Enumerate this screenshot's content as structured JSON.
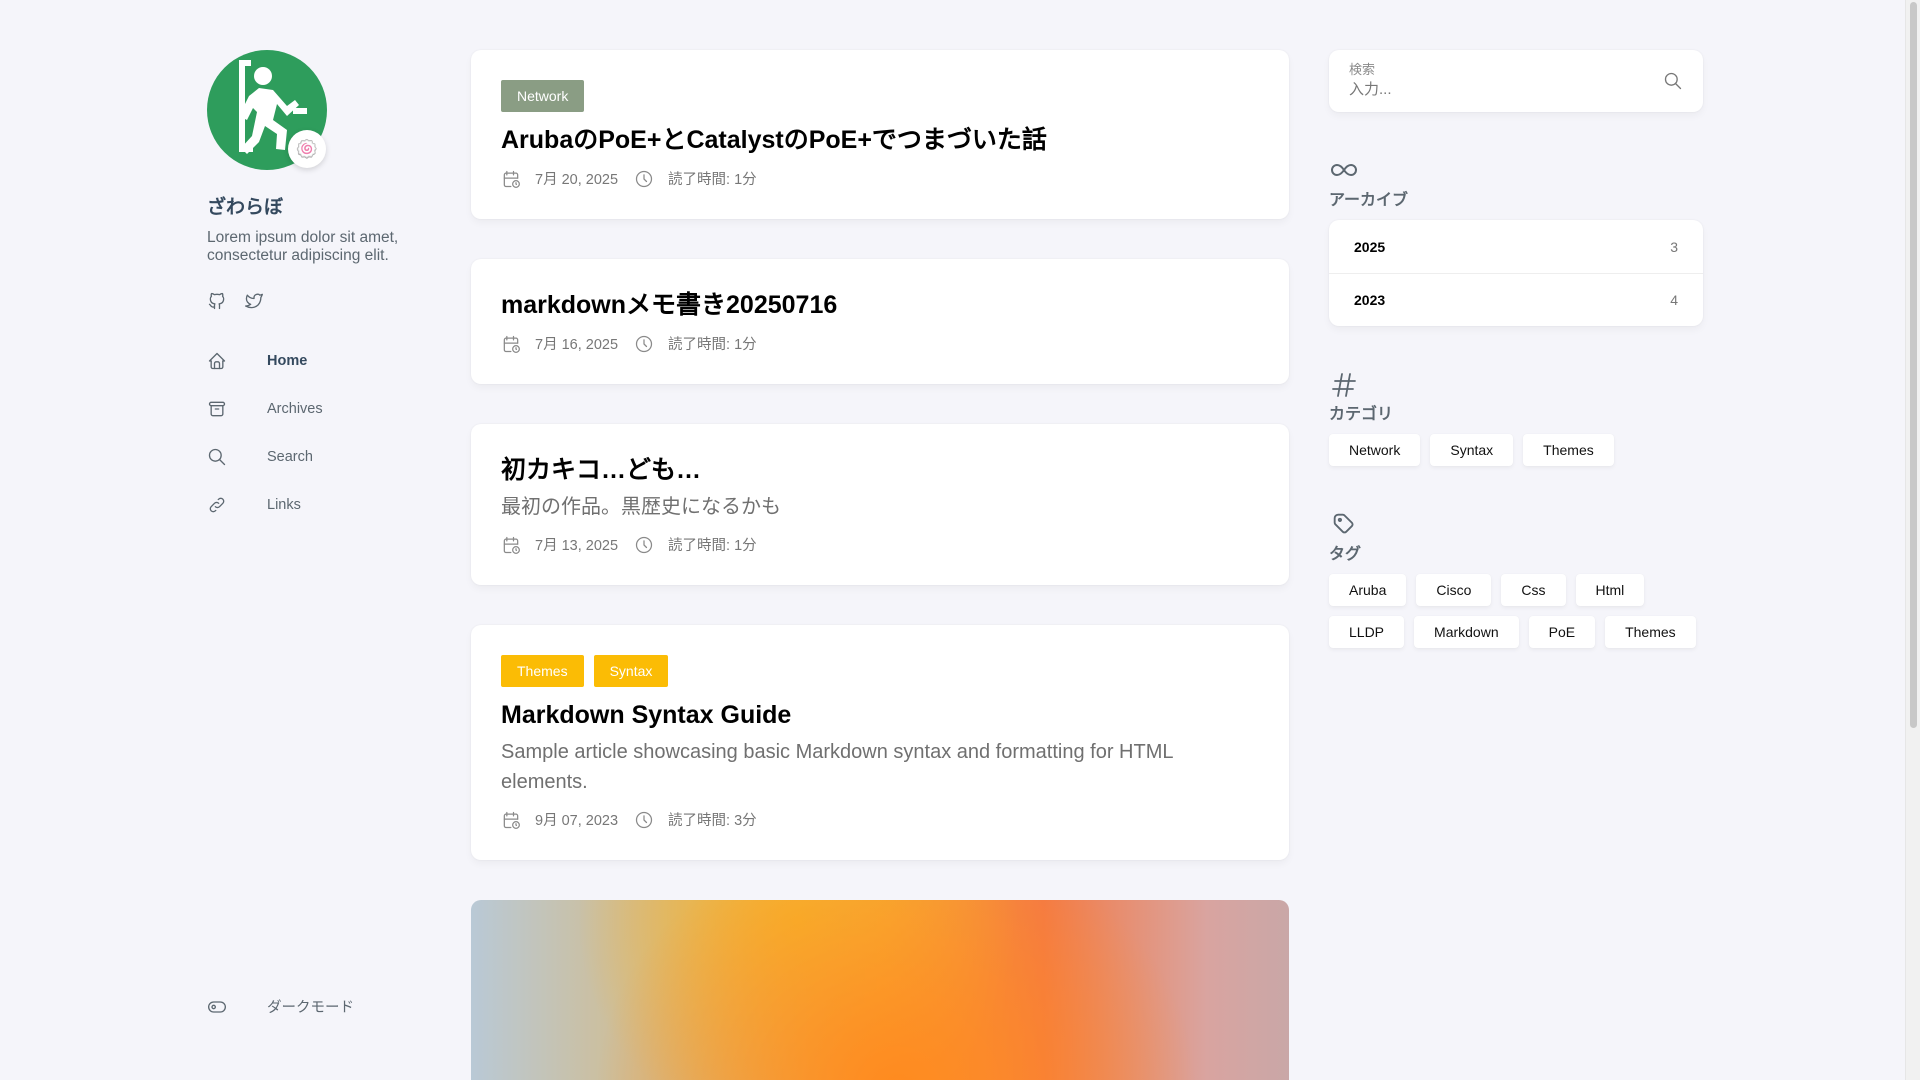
{
  "site": {
    "name": "ざわらぼ",
    "description": "Lorem ipsum dolor sit amet, consectetur adipiscing elit.",
    "avatar_emoji": "🍥",
    "avatar_color": "#2e9d5c"
  },
  "social": [
    {
      "name": "github-icon"
    },
    {
      "name": "twitter-icon"
    }
  ],
  "nav": [
    {
      "label": "Home",
      "icon": "home-icon",
      "active": true
    },
    {
      "label": "Archives",
      "icon": "archive-icon",
      "active": false
    },
    {
      "label": "Search",
      "icon": "search-icon",
      "active": false
    },
    {
      "label": "Links",
      "icon": "link-icon",
      "active": false
    }
  ],
  "dark_mode_label": "ダークモード",
  "posts": [
    {
      "categories": [
        {
          "label": "Network",
          "color": "#8a9d84"
        }
      ],
      "title": "ArubaのPoE+とCatalystのPoE+でつまづいた話",
      "subtitle": "",
      "date": "7月 20, 2025",
      "reading": "読了時間: 1分"
    },
    {
      "categories": [],
      "title": "markdownメモ書き20250716",
      "subtitle": "",
      "date": "7月 16, 2025",
      "reading": "読了時間: 1分"
    },
    {
      "categories": [],
      "title": "初カキコ…ども…",
      "subtitle": "最初の作品。黒歴史になるかも",
      "date": "7月 13, 2025",
      "reading": "読了時間: 1分"
    },
    {
      "categories": [
        {
          "label": "Themes",
          "color": "#fbbc05"
        },
        {
          "label": "Syntax",
          "color": "#fbbc05"
        }
      ],
      "title": "Markdown Syntax Guide",
      "subtitle": "Sample article showcasing basic Markdown syntax and formatting for HTML elements.",
      "date": "9月 07, 2023",
      "reading": "読了時間: 3分"
    }
  ],
  "search": {
    "label": "検索",
    "placeholder": "入力..."
  },
  "archives": {
    "title": "アーカイブ",
    "icon": "infinity-icon",
    "items": [
      {
        "year": "2025",
        "count": "3"
      },
      {
        "year": "2023",
        "count": "4"
      }
    ]
  },
  "categories": {
    "title": "カテゴリ",
    "icon": "hash-icon",
    "items": [
      "Network",
      "Syntax",
      "Themes"
    ]
  },
  "tags": {
    "title": "タグ",
    "icon": "tag-icon",
    "items": [
      "Aruba",
      "Cisco",
      "Css",
      "Html",
      "LLDP",
      "Markdown",
      "PoE",
      "Themes"
    ]
  }
}
